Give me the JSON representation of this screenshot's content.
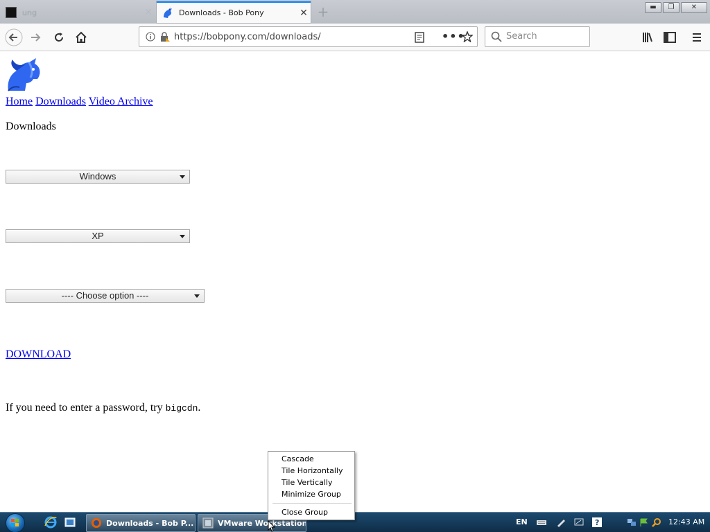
{
  "browser": {
    "tabs": [
      {
        "title": "ung",
        "active": false
      },
      {
        "title": "Downloads - Bob Pony",
        "active": true
      }
    ],
    "url": "https://bobpony.com/downloads/",
    "search_placeholder": "Search"
  },
  "page": {
    "nav_links": [
      "Home",
      "Downloads",
      "Video Archive"
    ],
    "heading": "Downloads",
    "selects": [
      {
        "value": "Windows"
      },
      {
        "value": "XP"
      },
      {
        "value": "---- Choose option ----"
      }
    ],
    "download_label": "DOWNLOAD",
    "password_note_prefix": "If you need to enter a password, try",
    "password": "bigcdn",
    "password_note_suffix": "."
  },
  "context_menu": {
    "items": [
      "Cascade",
      "Tile Horizontally",
      "Tile Vertically",
      "Minimize Group",
      "Close Group"
    ]
  },
  "taskbar": {
    "buttons": [
      "Downloads - Bob P...",
      "VMware Workstation"
    ],
    "language": "EN",
    "clock": "12:43 AM"
  },
  "colors": {
    "link": "#0000ee",
    "tab_accent": "#0a84ff",
    "taskbar": "#1c4a6e"
  },
  "icons": {
    "back": "arrow-left-icon",
    "forward": "arrow-right-icon",
    "reload": "reload-icon",
    "home": "home-icon",
    "info": "info-icon",
    "lock": "lock-icon",
    "reader": "reader-view-icon",
    "more": "page-actions-icon",
    "bookmark": "star-icon",
    "search": "search-icon",
    "library": "library-icon",
    "sidebar": "sidebar-icon",
    "menu": "hamburger-menu-icon"
  }
}
